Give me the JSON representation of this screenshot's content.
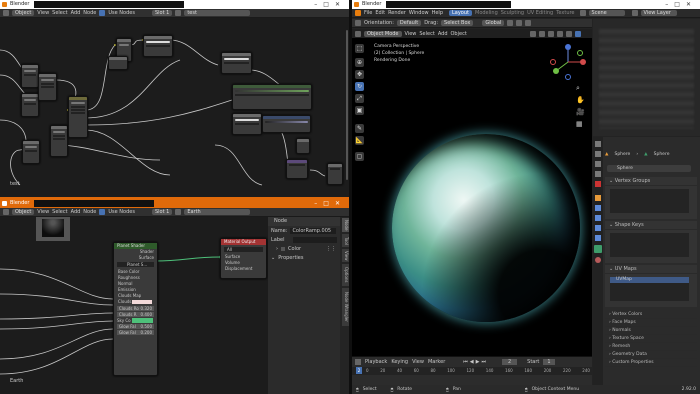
{
  "windows": {
    "left_top": {
      "title": "Blender",
      "header": {
        "editor": "Object",
        "menus": [
          "View",
          "Select",
          "Add",
          "Node"
        ],
        "use_nodes": "Use Nodes",
        "slot": "Slot 1",
        "material": "test"
      },
      "footer_label": "test"
    },
    "left_bottom": {
      "title": "Blender",
      "header": {
        "editor": "Object",
        "menus": [
          "View",
          "Select",
          "Add",
          "Node"
        ],
        "use_nodes": "Use Nodes",
        "slot": "Slot 1",
        "material": "Earth"
      },
      "footer_label": "Earth",
      "node_panel": {
        "section": "Node",
        "name_label": "Name:",
        "name_value": "ColorRamp.005",
        "label_label": "Label",
        "color_label": "Color",
        "properties_label": "Properties"
      },
      "side_tabs": [
        "Node",
        "Tool",
        "View",
        "Options",
        "Node Wrangler"
      ],
      "shader_node": {
        "title": "Planet Shader",
        "outputs": [
          "Shader",
          "Surface"
        ],
        "slot": "Planet S...",
        "inputs": [
          "Base Color",
          "Roughness",
          "Normal",
          "Emission",
          "Clouds Map",
          "Clouds"
        ],
        "fields": [
          {
            "label": "Clouds Ro",
            "value": "0.320"
          },
          {
            "label": "Clouds R",
            "value": "0.400"
          },
          {
            "label": "Sky Co",
            "value": ""
          },
          {
            "label": "Glow Fal",
            "value": "0.500"
          },
          {
            "label": "Glow Fal",
            "value": "0.200"
          }
        ]
      },
      "output_node": {
        "title": "Material Output",
        "target": "All",
        "inputs": [
          "Surface",
          "Volume",
          "Displacement"
        ]
      }
    },
    "right": {
      "title": "Blender",
      "menus": [
        "File",
        "Edit",
        "Render",
        "Window",
        "Help"
      ],
      "workspaces": [
        "Layout",
        "Modeling",
        "Sculpting",
        "UV Editing",
        "Texture"
      ],
      "scene": "Scene",
      "view_layer": "View Layer",
      "viewport_header": {
        "orientation_label": "Orientation:",
        "orientation": "Default",
        "drag_label": "Drag:",
        "drag": "Select Box",
        "transform": "Global",
        "mode": "Object Mode",
        "menus": [
          "View",
          "Select",
          "Add",
          "Object"
        ]
      },
      "overlay_text": [
        "Camera Perspective",
        "(2) Collection | Sphere",
        "Rendering Done"
      ],
      "timeline": {
        "menus": [
          "Playback",
          "Keying",
          "View",
          "Marker"
        ],
        "current_frame": "2",
        "start_label": "Start",
        "start": "1",
        "ticks": [
          "0",
          "20",
          "40",
          "60",
          "80",
          "100",
          "120",
          "140",
          "160",
          "180",
          "200",
          "220",
          "240"
        ]
      },
      "statusbar": {
        "select": "Select",
        "rotate": "Rotate",
        "pan": "Pan",
        "context": "Object Context Menu",
        "version": "2.92.0"
      },
      "properties": {
        "object_name": "Sphere",
        "data_name": "Sphere",
        "mesh_name": "Sphere",
        "sections_closed_top": [],
        "vertex_groups": "Vertex Groups",
        "shape_keys": "Shape Keys",
        "uv_maps": "UV Maps",
        "uv_map_item": "UVMap",
        "closed_sections": [
          "Vertex Colors",
          "Face Maps",
          "Normals",
          "Texture Space",
          "Remesh",
          "Geometry Data",
          "Custom Properties"
        ]
      }
    }
  },
  "colors": {
    "accent": "#4772b3",
    "node_red": "#a33333",
    "node_green": "#4a8a3a",
    "sky": "#4ec07a"
  }
}
